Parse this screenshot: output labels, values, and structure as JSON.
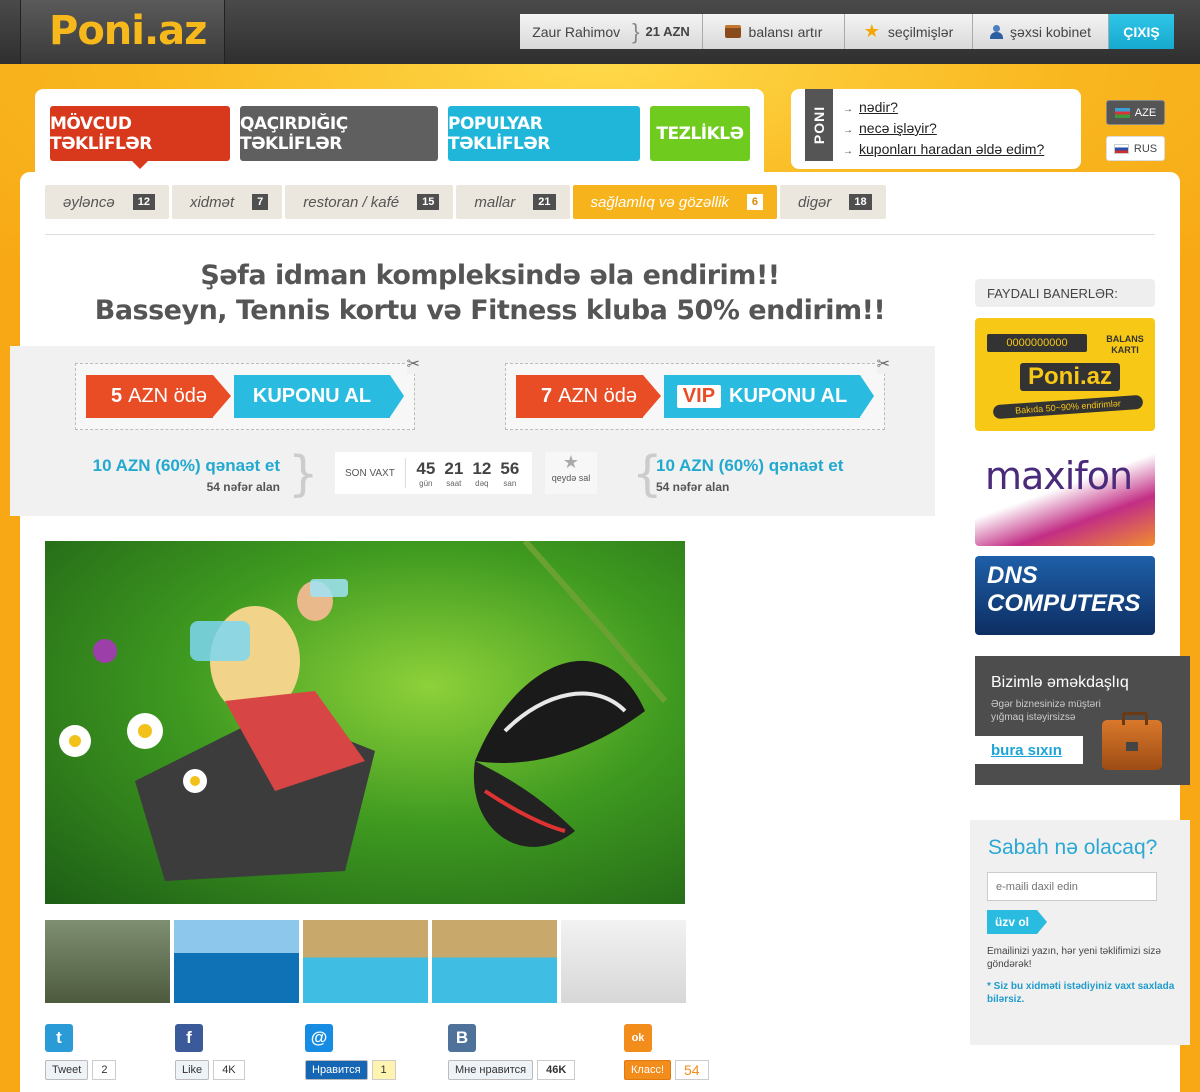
{
  "header": {
    "logo": "Poni.az",
    "user_name": "Zaur Rahimov",
    "balance": "21 AZN",
    "nav": {
      "topup": "balansı artır",
      "favorites": "seçilmişlər",
      "cabinet": "şəxsi kobinet",
      "exit": "ÇIXIŞ"
    }
  },
  "tabs": [
    "MÖVCUD TƏKLİFLƏR",
    "QAÇIRDIĞIÇ TƏKLİFLƏR",
    "POPULYAR TƏKLİFLƏR",
    "TEZLİKLƏ"
  ],
  "poni_info": {
    "side_label": "PONI",
    "links": [
      "nədir?",
      "necə işləyir?",
      "kuponları haradan əldə edim?"
    ]
  },
  "languages": [
    "AZE",
    "RUS"
  ],
  "categories": [
    {
      "label": "əyləncə",
      "count": "12"
    },
    {
      "label": "xidmət",
      "count": "7"
    },
    {
      "label": "restoran / kafé",
      "count": "15"
    },
    {
      "label": "mallar",
      "count": "21"
    },
    {
      "label": "sağlamlıq və gözəllik",
      "count": "6"
    },
    {
      "label": "digər",
      "count": "18"
    }
  ],
  "headline": {
    "line1": "Şəfa idman kompleksində əla endirim!!",
    "line2": "Basseyn, Tennis kortu və Fitness kluba 50% endirim!!"
  },
  "coupons": [
    {
      "pay_amount": "5",
      "pay_text": "AZN ödə",
      "buy_label": "KUPONU AL",
      "badge": ""
    },
    {
      "pay_amount": "7",
      "pay_text": "AZN ödə",
      "buy_label": "KUPONU AL",
      "badge": "VIP"
    }
  ],
  "savings": [
    {
      "text": "10 AZN (60%) qənaət et",
      "buyers": "54 nəfər alan"
    },
    {
      "text": "10 AZN (60%) qənaət et",
      "buyers": "54 nəfər alan"
    }
  ],
  "timer": {
    "label": "SON VAXT",
    "units": [
      {
        "value": "45",
        "unit": "gün"
      },
      {
        "value": "21",
        "unit": "saat"
      },
      {
        "value": "12",
        "unit": "dəq"
      },
      {
        "value": "56",
        "unit": "san"
      }
    ],
    "remind_label": "qeydə sal"
  },
  "social": [
    {
      "name": "twitter",
      "icon": "t",
      "button": "Tweet",
      "count": "2",
      "color": "#2b9bd8"
    },
    {
      "name": "facebook",
      "icon": "f",
      "button": "Like",
      "count": "4K",
      "color": "#3b5a9a"
    },
    {
      "name": "mailru",
      "icon": "@",
      "button": "Нравится",
      "count": "1",
      "color": "#168de2"
    },
    {
      "name": "vkontakte",
      "icon": "B",
      "button": "Мне нравится",
      "count": "46K",
      "color": "#4e729a"
    },
    {
      "name": "odnoklassniki",
      "icon": "ok",
      "button": "Класс!",
      "count": "54",
      "color": "#f28c1b"
    }
  ],
  "sidebar": {
    "banners_label": "FAYDALI BANERLƏR:",
    "poni_card": {
      "code": "0000000000",
      "title": "BALANS KARTI",
      "logo": "Poni.az",
      "slogan": "Bakıda 50~90% endirimlər"
    },
    "maxifon": "maxifon",
    "dns": "DNS COMPUTERS",
    "coop": {
      "title": "Bizimlə əməkdaşlıq",
      "desc": "Əgər biznesinizə müştəri yığmaq istəyirsizsə",
      "button": "bura sıxın"
    },
    "newsletter": {
      "title": "Sabah nə olacaq?",
      "placeholder": "e-maili daxil edin",
      "button": "üzv ol",
      "note": "Emailinizi yazın, hər yeni təklifimizi sizə göndərək!",
      "note2": "* Siz bu xidməti istədiyiniz vaxt saxlada bilərsiz."
    }
  },
  "colors": {
    "brand_orange": "#f7a814",
    "accent_blue": "#29bce0",
    "accent_red": "#e84d26"
  }
}
